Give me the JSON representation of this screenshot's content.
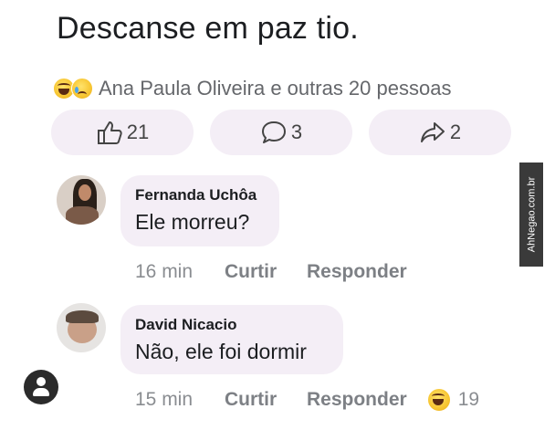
{
  "post": {
    "text": "Descanse em paz tio.",
    "reactions_summary": "Ana Paula Oliveira e outras 20 pessoas",
    "reaction_icons": [
      "laugh-emoji-icon",
      "sad-emoji-icon"
    ]
  },
  "actions": {
    "like_count": "21",
    "comment_count": "3",
    "share_count": "2"
  },
  "comments": [
    {
      "author": "Fernanda Uchôa",
      "text": "Ele morreu?",
      "time": "16 min",
      "like_label": "Curtir",
      "reply_label": "Responder"
    },
    {
      "author": "David Nicacio",
      "text": "Não, ele foi dormir",
      "time": "15 min",
      "like_label": "Curtir",
      "reply_label": "Responder",
      "reaction_icon": "laugh-emoji-icon",
      "reaction_count": "19"
    }
  ],
  "watermark": "AhNegao.com.br",
  "colors": {
    "bubble": "#f4eef6",
    "muted_text": "#8a8d91",
    "primary_text": "#1c1e21"
  }
}
